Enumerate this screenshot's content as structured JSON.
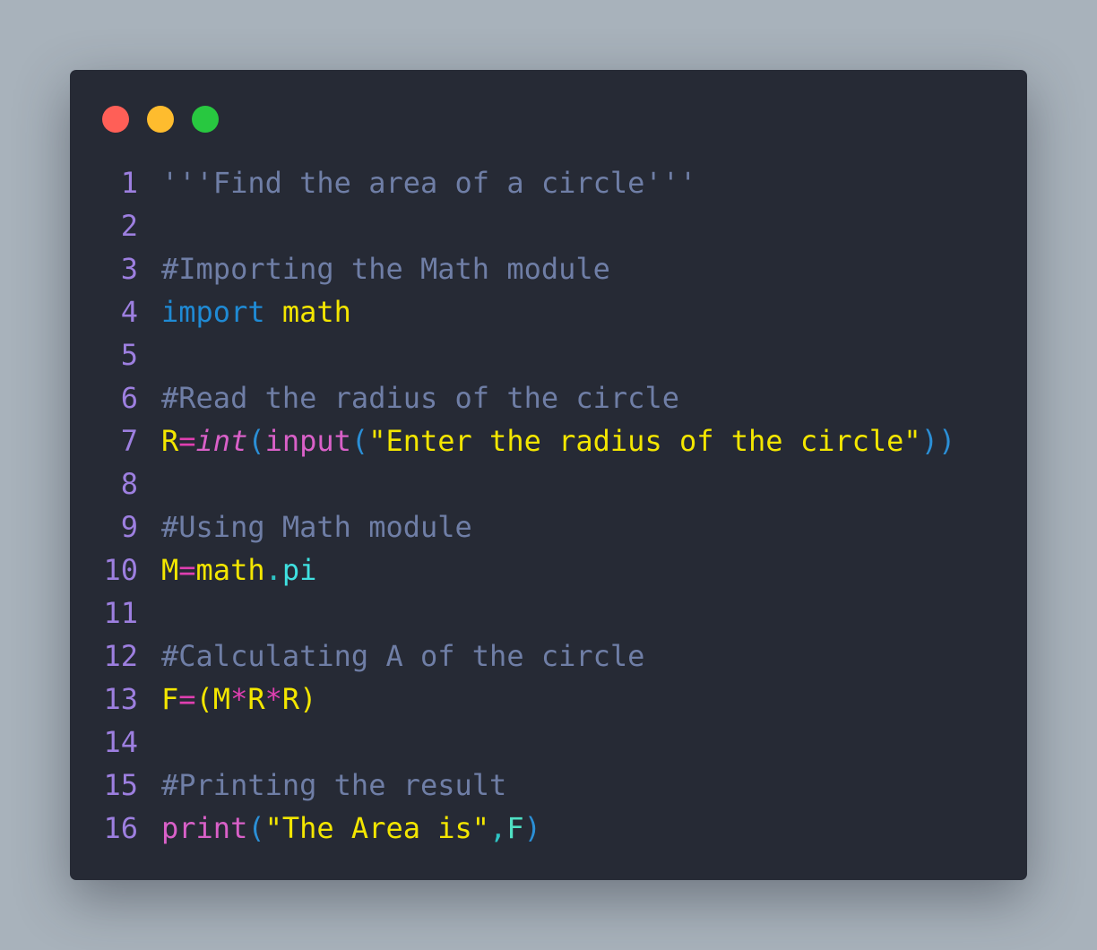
{
  "window": {
    "buttons": [
      {
        "name": "close",
        "color": "#ff5f57"
      },
      {
        "name": "minimize",
        "color": "#febc2e"
      },
      {
        "name": "maximize",
        "color": "#28c840"
      }
    ]
  },
  "code": {
    "language": "python",
    "lines": [
      {
        "n": "1",
        "tokens": [
          {
            "t": "'''Find the area of a circle'''",
            "k": "comment"
          }
        ]
      },
      {
        "n": "2",
        "tokens": []
      },
      {
        "n": "3",
        "tokens": [
          {
            "t": "#Importing the Math module",
            "k": "comment"
          }
        ]
      },
      {
        "n": "4",
        "tokens": [
          {
            "t": "import",
            "k": "keyword"
          },
          {
            "t": " ",
            "k": "space"
          },
          {
            "t": "math",
            "k": "module"
          }
        ]
      },
      {
        "n": "5",
        "tokens": []
      },
      {
        "n": "6",
        "tokens": [
          {
            "t": "#Read the radius of the circle",
            "k": "comment"
          }
        ]
      },
      {
        "n": "7",
        "tokens": [
          {
            "t": "R",
            "k": "var"
          },
          {
            "t": "=",
            "k": "op"
          },
          {
            "t": "int",
            "k": "builtin-italic"
          },
          {
            "t": "(",
            "k": "paren"
          },
          {
            "t": "input",
            "k": "func"
          },
          {
            "t": "(",
            "k": "paren"
          },
          {
            "t": "\"Enter the radius of the circle\"",
            "k": "string"
          },
          {
            "t": "))",
            "k": "paren"
          }
        ]
      },
      {
        "n": "8",
        "tokens": []
      },
      {
        "n": "9",
        "tokens": [
          {
            "t": "#Using Math module",
            "k": "comment"
          }
        ]
      },
      {
        "n": "10",
        "tokens": [
          {
            "t": "M",
            "k": "var"
          },
          {
            "t": "=",
            "k": "op"
          },
          {
            "t": "math",
            "k": "module"
          },
          {
            "t": ".",
            "k": "dot"
          },
          {
            "t": "pi",
            "k": "attr"
          }
        ]
      },
      {
        "n": "11",
        "tokens": []
      },
      {
        "n": "12",
        "tokens": [
          {
            "t": "#Calculating A of the circle",
            "k": "comment"
          }
        ]
      },
      {
        "n": "13",
        "tokens": [
          {
            "t": "F",
            "k": "var"
          },
          {
            "t": "=",
            "k": "op"
          },
          {
            "t": "(M",
            "k": "var"
          },
          {
            "t": "*",
            "k": "op"
          },
          {
            "t": "R",
            "k": "var"
          },
          {
            "t": "*",
            "k": "op"
          },
          {
            "t": "R)",
            "k": "var"
          }
        ]
      },
      {
        "n": "14",
        "tokens": []
      },
      {
        "n": "15",
        "tokens": [
          {
            "t": "#Printing the result",
            "k": "comment"
          }
        ]
      },
      {
        "n": "16",
        "tokens": [
          {
            "t": "print",
            "k": "func"
          },
          {
            "t": "(",
            "k": "paren"
          },
          {
            "t": "\"The Area is\"",
            "k": "string"
          },
          {
            "t": ",",
            "k": "punct"
          },
          {
            "t": "F",
            "k": "arg"
          },
          {
            "t": ")",
            "k": "paren"
          }
        ]
      }
    ]
  }
}
